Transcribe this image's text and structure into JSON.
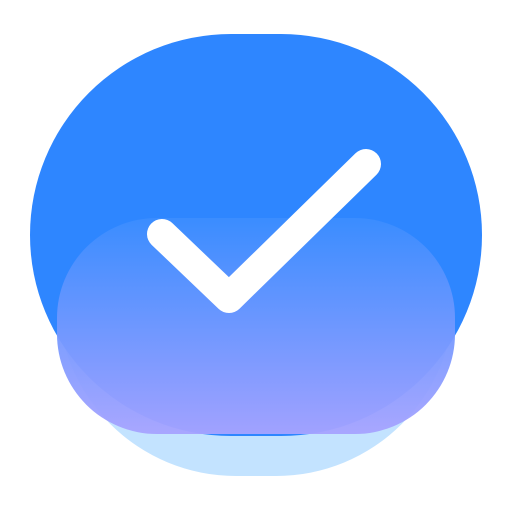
{
  "icon": {
    "name": "checkmark-icon",
    "colors": {
      "background": "#ffffff",
      "primary": "#2e86ff",
      "shadow_base": "#c3e3ff",
      "gradient_top": "#3b8dff",
      "gradient_bottom": "#a7a3ff",
      "check": "#ffffff"
    }
  }
}
